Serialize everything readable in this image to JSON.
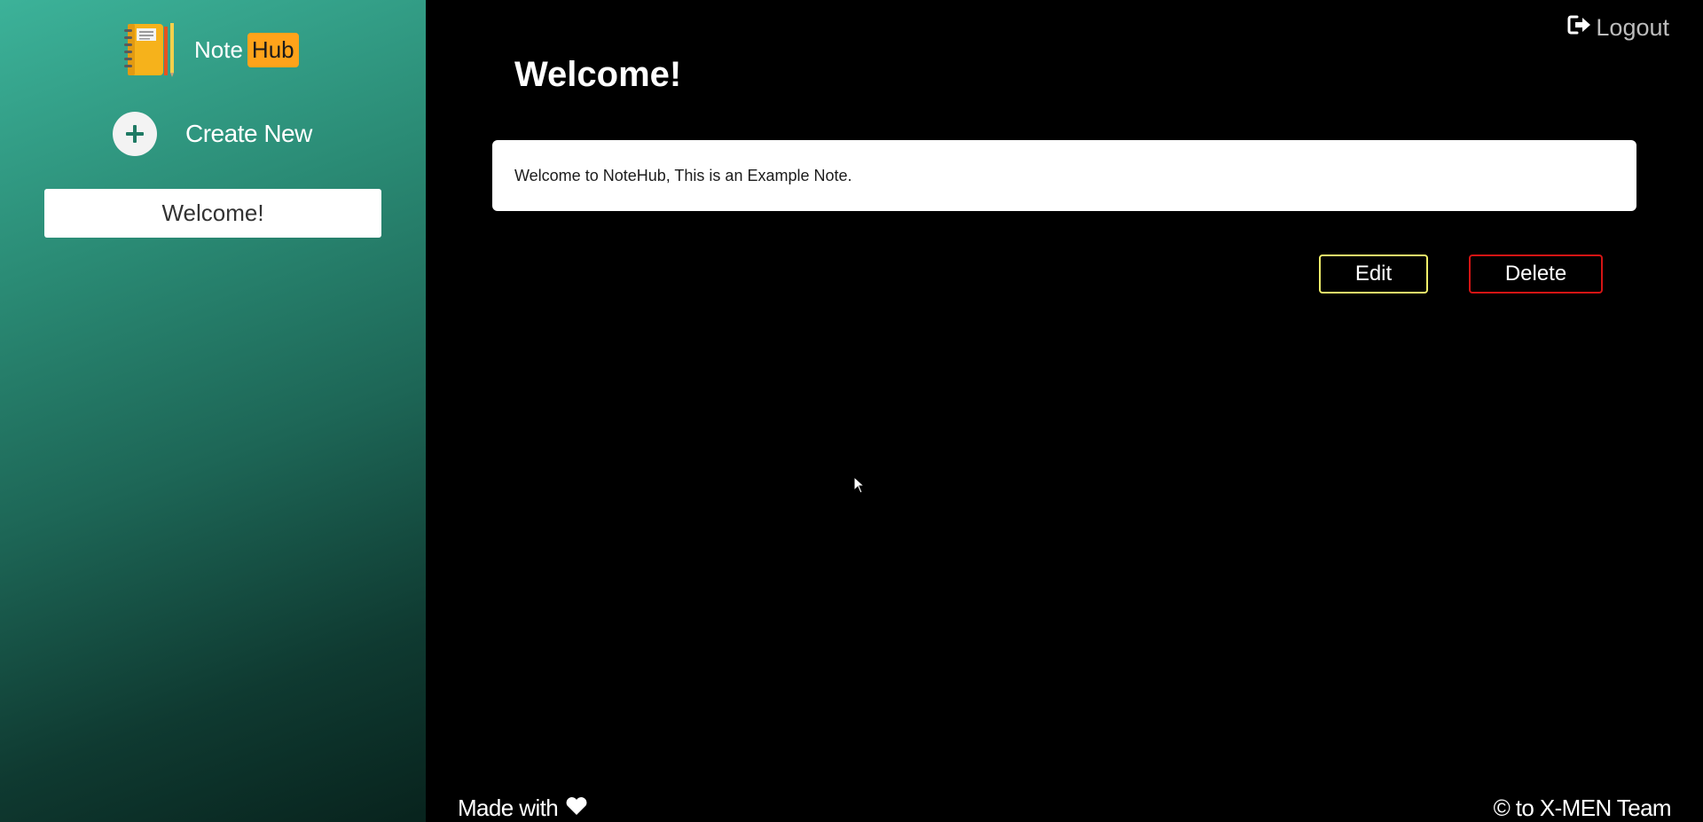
{
  "brand": {
    "name_part1": "Note",
    "name_part2": "Hub",
    "hub_color": "#ffa31a",
    "logo_icon": "notebook-icon"
  },
  "sidebar": {
    "create_new_label": "Create New",
    "create_icon": "plus-icon",
    "notes": [
      {
        "title": "Welcome!"
      }
    ],
    "gradient_colors": [
      "#3cb299",
      "#08231d"
    ]
  },
  "header": {
    "logout_label": "Logout",
    "logout_icon": "logout-icon"
  },
  "note": {
    "title": "Welcome!",
    "body": "Welcome to NoteHub, This is an Example Note."
  },
  "actions": {
    "edit_label": "Edit",
    "edit_border_color": "#f0ee6a",
    "delete_label": "Delete",
    "delete_border_color": "#d41414"
  },
  "footer": {
    "made_with_label": "Made with",
    "heart_icon": "heart-icon",
    "credit": "© to X-MEN Team"
  }
}
